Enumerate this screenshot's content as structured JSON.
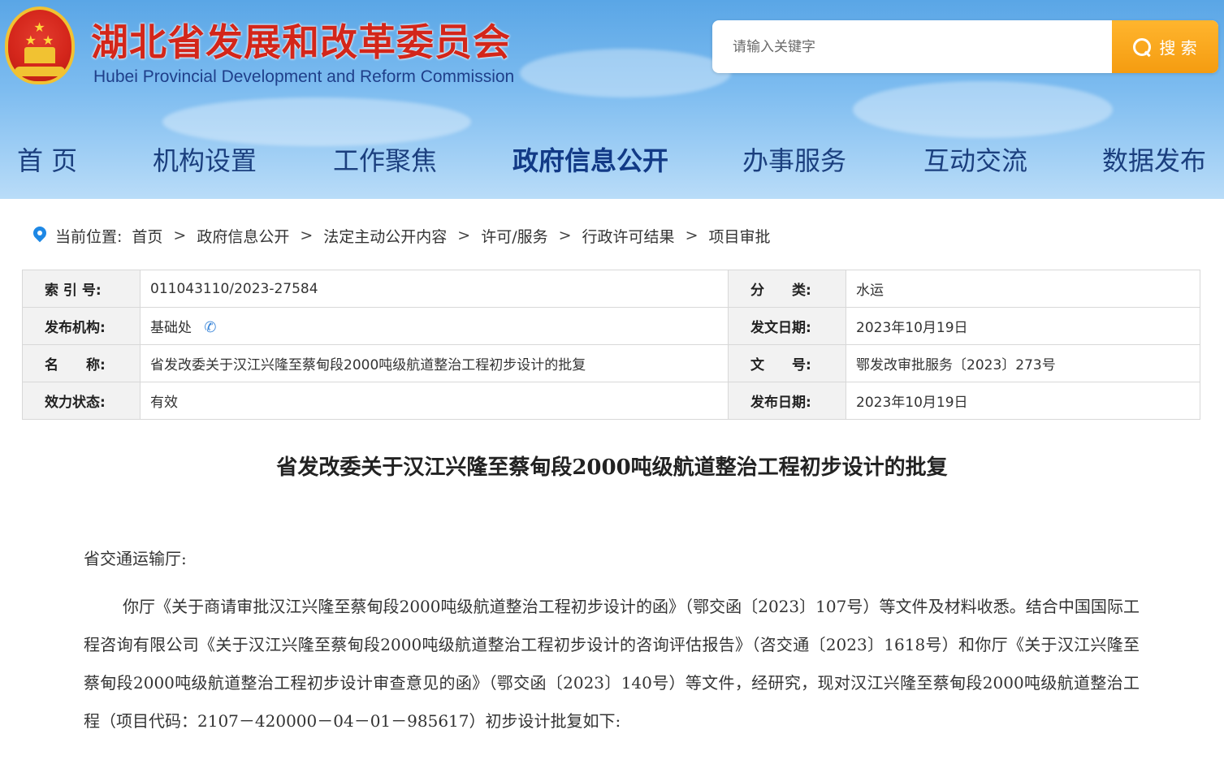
{
  "header": {
    "title_cn": "湖北省发展和改革委员会",
    "title_en": "Hubei Provincial Development and Reform Commission",
    "search": {
      "placeholder": "请输入关键字",
      "button_label": "搜 索"
    }
  },
  "nav": {
    "items": [
      {
        "label": "首 页"
      },
      {
        "label": "机构设置"
      },
      {
        "label": "工作聚焦"
      },
      {
        "label": "政府信息公开",
        "active": true
      },
      {
        "label": "办事服务"
      },
      {
        "label": "互动交流"
      },
      {
        "label": "数据发布"
      }
    ]
  },
  "breadcrumb": {
    "prefix": "当前位置:",
    "items": [
      "首页",
      "政府信息公开",
      "法定主动公开内容",
      "许可/服务",
      "行政许可结果",
      "项目审批"
    ],
    "separator": ">"
  },
  "meta": {
    "index_label": "索 引 号:",
    "index_value": "011043110/2023-27584",
    "category_label": "分　　类:",
    "category_value": "水运",
    "publisher_label": "发布机构:",
    "publisher_value": "基础处",
    "issue_date_label": "发文日期:",
    "issue_date_value": "2023年10月19日",
    "name_label": "名　　称:",
    "name_value": "省发改委关于汉江兴隆至蔡甸段2000吨级航道整治工程初步设计的批复",
    "doc_no_label": "文　　号:",
    "doc_no_value": "鄂发改审批服务〔2023〕273号",
    "status_label": "效力状态:",
    "status_value": "有效",
    "publish_date_label": "发布日期:",
    "publish_date_value": "2023年10月19日"
  },
  "document": {
    "title": "省发改委关于汉江兴隆至蔡甸段2000吨级航道整治工程初步设计的批复",
    "addressee": "省交通运输厅:",
    "paragraph": "你厅《关于商请审批汉江兴隆至蔡甸段2000吨级航道整治工程初步设计的函》（鄂交函〔2023〕107号）等文件及材料收悉。结合中国国际工程咨询有限公司《关于汉江兴隆至蔡甸段2000吨级航道整治工程初步设计的咨询评估报告》（咨交通〔2023〕1618号）和你厅《关于汉江兴隆至蔡甸段2000吨级航道整治工程初步设计审查意见的函》（鄂交函〔2023〕140号）等文件，经研究，现对汉江兴隆至蔡甸段2000吨级航道整治工程（项目代码：2107－420000－04－01－985617）初步设计批复如下:"
  },
  "colors": {
    "title_red": "#d3261a",
    "nav_blue": "#1b3f7e",
    "search_orange": "#f59c10",
    "link_blue": "#1e88e5"
  },
  "icons": {
    "emblem": "national-emblem-icon",
    "search": "magnifier-icon",
    "location": "location-pin-icon",
    "phone": "phone-icon"
  }
}
